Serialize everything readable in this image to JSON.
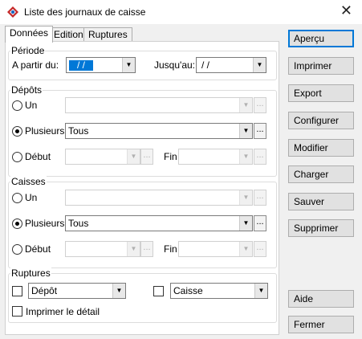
{
  "window": {
    "title": "Liste des journaux de caisse",
    "close_glyph": "✕",
    "app_icon": "red-diamond-app-icon"
  },
  "tabs": [
    {
      "label": "Données",
      "active": true
    },
    {
      "label": "Edition",
      "active": false
    },
    {
      "label": "Ruptures",
      "active": false
    }
  ],
  "periode": {
    "legend": "Période",
    "from_label": "A partir du:",
    "from_value": "/ /",
    "to_label": "Jusqu'au:",
    "to_value": "/ /"
  },
  "depots": {
    "legend": "Dépôts",
    "un_label": "Un",
    "plusieurs_label": "Plusieurs",
    "plusieurs_value": "Tous",
    "debut_label": "Début",
    "fin_label": "Fin",
    "selected": "plusieurs"
  },
  "caisses": {
    "legend": "Caisses",
    "un_label": "Un",
    "plusieurs_label": "Plusieurs",
    "plusieurs_value": "Tous",
    "debut_label": "Début",
    "fin_label": "Fin",
    "selected": "plusieurs"
  },
  "ruptures": {
    "legend": "Ruptures",
    "rupture1_value": "Dépôt",
    "rupture2_value": "Caisse",
    "detail_label": "Imprimer le détail"
  },
  "buttons": {
    "apercu": "Aperçu",
    "imprimer": "Imprimer",
    "export": "Export",
    "configurer": "Configurer",
    "modifier": "Modifier",
    "charger": "Charger",
    "sauver": "Sauver",
    "supprimer": "Supprimer",
    "aide": "Aide",
    "fermer": "Fermer"
  },
  "glyphs": {
    "dropdown": "▼",
    "ellipsis": "..."
  },
  "colors": {
    "accent": "#0078d7",
    "panel_bg": "#f0f0f0"
  }
}
